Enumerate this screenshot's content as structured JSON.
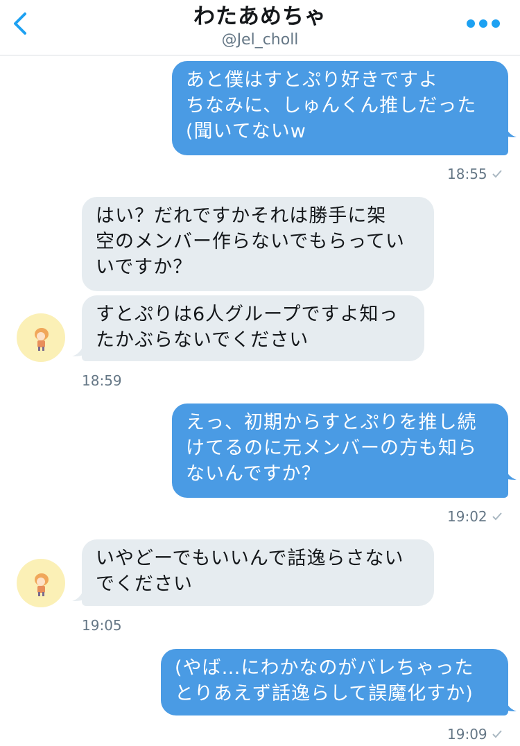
{
  "header": {
    "title": "わたあめちゃ",
    "handle": "@Jel_choll",
    "back_icon": "chevron-left-icon",
    "more_icon": "more-horizontal-icon",
    "accent": "#1da1f2"
  },
  "colors": {
    "outgoing_bubble": "#4a9be4",
    "incoming_bubble": "#e6ecf0",
    "timestamp": "#657786"
  },
  "messages": [
    {
      "direction": "out",
      "text": "あと僕はすとぷり好きですよ\nちなみに、しゅんくん推しだった\n(聞いてないw"
    },
    {
      "direction": "out_time",
      "time": "18:55"
    },
    {
      "direction": "in",
      "text": "はい？だれですかそれは勝手に架\n空のメンバー作らないでもらってい\nいですか？"
    },
    {
      "direction": "in",
      "text": "すとぷりは6人グループですよ知っ\nたかぶらないでください"
    },
    {
      "direction": "in_time",
      "time": "18:59"
    },
    {
      "direction": "out",
      "text": "えっ、初期からすとぷりを推し続\nけてるのに元メンバーの方も知ら\nないんですか？"
    },
    {
      "direction": "out_time",
      "time": "19:02"
    },
    {
      "direction": "in",
      "text": "いやどーでもいいんで話逸らさない\nでください"
    },
    {
      "direction": "in_time",
      "time": "19:05"
    },
    {
      "direction": "out",
      "text": "(やば…にわかなのがバレちゃった\nとりあえず話逸らして誤魔化すか)"
    },
    {
      "direction": "out_time",
      "time": "19:09"
    }
  ]
}
